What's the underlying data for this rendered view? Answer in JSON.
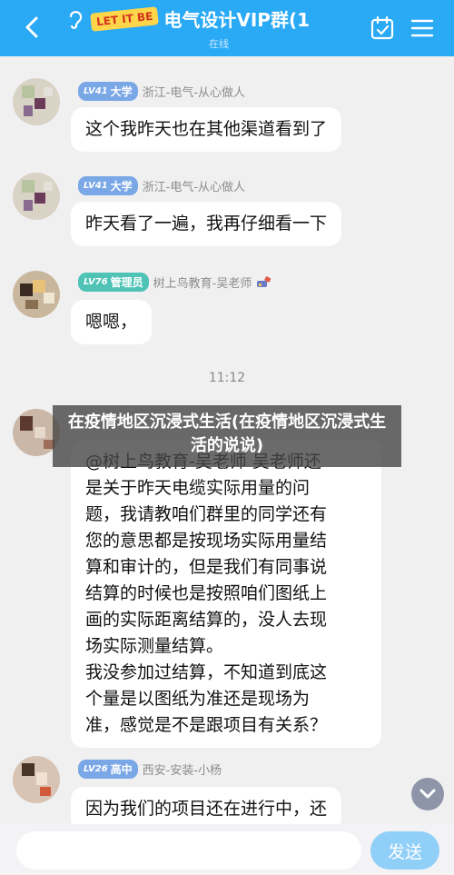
{
  "header": {
    "badge": "LET IT BE",
    "title": "电气设计VIP群(1",
    "subtitle": "在线",
    "colors": {
      "bar": "#2aa9f5",
      "badge_bg": "#ffd54a",
      "badge_text": "#d0341c"
    }
  },
  "messages": [
    {
      "level": "LV41",
      "rank": "大学",
      "sender": "浙江-电气-从心做人",
      "text": "这个我昨天也在其他渠道看到了"
    },
    {
      "level": "LV41",
      "rank": "大学",
      "sender": "浙江-电气-从心做人",
      "text": "昨天看了一遍，我再仔细看一下"
    },
    {
      "level": "LV76",
      "rank": "管理员",
      "sender": "树上鸟教育-吴老师",
      "text": "嗯嗯，"
    },
    {
      "lines": [
        "@树上鸟教育-吴老师 吴老师还",
        "是关于昨天电缆实际用量的问",
        "题，我请教咱们群里的同学还有",
        "您的意思都是按现场实际用量结",
        "算和审计的，但是我们有同事说",
        "结算的时候也是按照咱们图纸上",
        "画的实际距离结算的，没人去现",
        "场实际测量结算。",
        "我没参加过结算，不知道到底这",
        "个量是以图纸为准还是现场为",
        "准，感觉是不是跟项目有关系？"
      ]
    },
    {
      "level": "LV26",
      "rank": "高中",
      "sender": "西安-安装-小杨",
      "text": "因为我们的项目还在进行中，还"
    }
  ],
  "timestamp": "11:12",
  "banner": "在疫情地区沉浸式生活(在疫情地区沉浸式生活的说说)",
  "input": {
    "placeholder": "",
    "value": ""
  },
  "send_label": "发送"
}
